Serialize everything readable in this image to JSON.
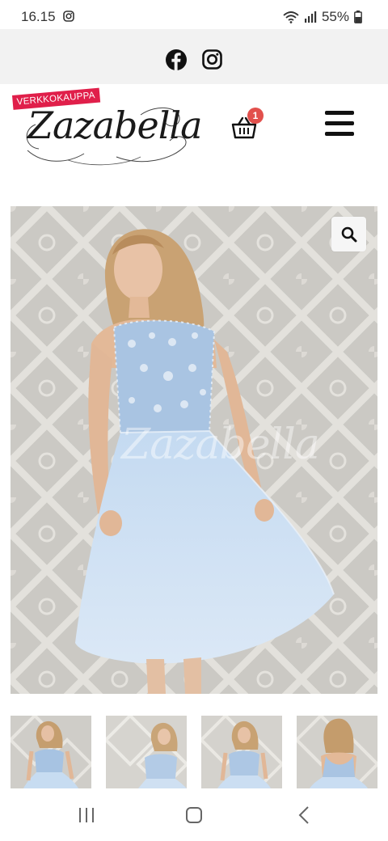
{
  "status_bar": {
    "time": "16.15",
    "battery": "55%",
    "notification_icon": "instagram-icon",
    "icons": [
      "wifi-icon",
      "signal-icon",
      "battery-icon"
    ]
  },
  "social": {
    "links": [
      {
        "name": "facebook",
        "icon": "facebook-icon"
      },
      {
        "name": "instagram",
        "icon": "instagram-icon"
      }
    ]
  },
  "header": {
    "logo_tag": "VERKKOKAUPPA",
    "logo_text": "Zazabella",
    "cart_count": "1",
    "cart_icon": "basket-icon",
    "menu_icon": "hamburger-menu-icon"
  },
  "product": {
    "watermark": "Zazabella",
    "zoom_icon": "magnifier-icon",
    "thumbnail_count": 4
  },
  "colors": {
    "logo_tag_bg": "#e01f4a",
    "badge_bg": "#e2504c",
    "dress_blue": "#b9d3ee",
    "background_lace": "#cfcdc8"
  },
  "nav_bar": {
    "icons": [
      "recent-apps-icon",
      "home-icon",
      "back-icon"
    ]
  }
}
